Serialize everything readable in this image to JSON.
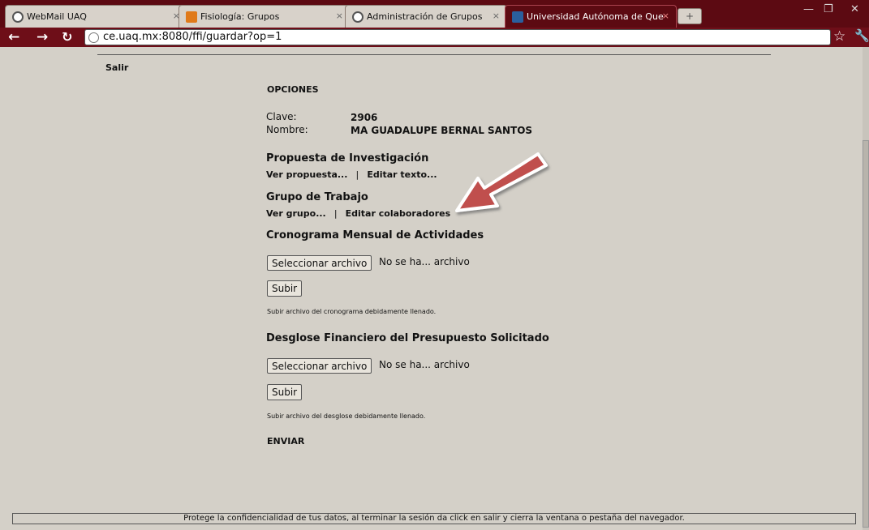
{
  "browser": {
    "tabs": [
      {
        "title": "WebMail UAQ",
        "icon": "globe-icon",
        "active": false
      },
      {
        "title": "Fisiología: Grupos",
        "icon": "moodle-icon",
        "active": false
      },
      {
        "title": "Administración de Grupos",
        "icon": "globe-icon",
        "active": false
      },
      {
        "title": "Universidad Autónoma de Que",
        "icon": "university-icon",
        "active": true
      }
    ],
    "url": "ce.uaq.mx:8080/ffi/guardar?op=1",
    "tab_close": "×",
    "new_tab": "+"
  },
  "page": {
    "salir": "Salir",
    "opciones": "OPCIONES",
    "clave_label": "Clave:",
    "clave_value": "2906",
    "nombre_label": "Nombre:",
    "nombre_value": "MA GUADALUPE BERNAL SANTOS",
    "propuesta": {
      "title": "Propuesta de Investigación",
      "ver": "Ver propuesta...",
      "editar": "Editar texto...",
      "sep": "|"
    },
    "grupo": {
      "title": "Grupo de Trabajo",
      "ver": "Ver grupo...",
      "editar": "Editar colaboradores",
      "sep": "|"
    },
    "cronograma": {
      "title": "Cronograma Mensual de Actividades",
      "file_button": "Seleccionar archivo",
      "file_status": "No se ha... archivo",
      "submit": "Subir",
      "help": "Subir archivo del cronograma debidamente llenado."
    },
    "desglose": {
      "title": "Desglose Financiero del Presupuesto Solicitado",
      "file_button": "Seleccionar archivo",
      "file_status": "No se ha... archivo",
      "submit": "Subir",
      "help": "Subir archivo del desglose debidamente llenado."
    },
    "enviar": "ENVIAR",
    "footer": "Protege la confidencialidad de tus datos, al terminar la sesión da click en salir y cierra la ventana o pestaña del navegador."
  },
  "colors": {
    "chrome_dark": "#5c0a12",
    "page_bg": "#d4d0c8",
    "arrow": "#c0504d"
  }
}
